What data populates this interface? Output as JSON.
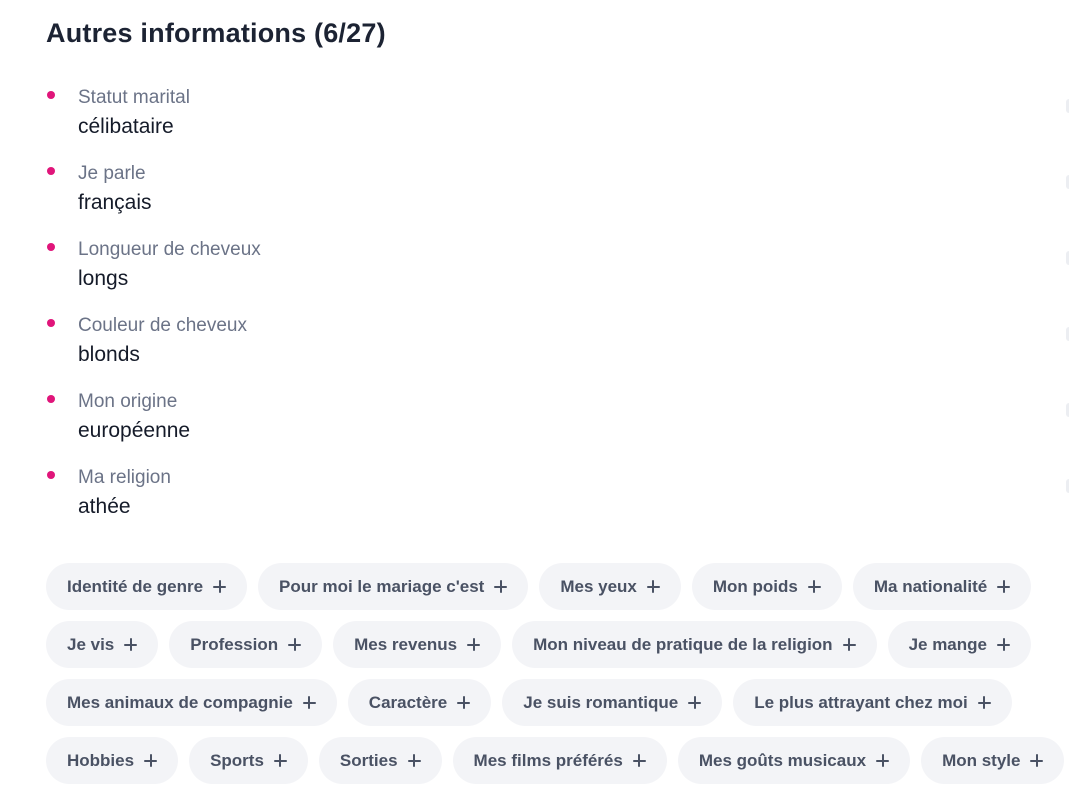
{
  "title": "Autres informations (6/27)",
  "info": [
    {
      "label": "Statut marital",
      "value": "célibataire"
    },
    {
      "label": "Je parle",
      "value": "français"
    },
    {
      "label": "Longueur de cheveux",
      "value": "longs"
    },
    {
      "label": "Couleur de cheveux",
      "value": "blonds"
    },
    {
      "label": "Mon origine",
      "value": "européenne"
    },
    {
      "label": "Ma religion",
      "value": "athée"
    }
  ],
  "chips": {
    "row1": [
      "Identité de genre",
      "Pour moi le mariage c'est",
      "Mes yeux",
      "Mon poids",
      "Ma nationalité"
    ],
    "row2": [
      "Je vis",
      "Profession",
      "Mes revenus",
      "Mon niveau de pratique de la religion",
      "Je mange"
    ],
    "row3": [
      "Mes animaux de compagnie",
      "Caractère",
      "Je suis romantique",
      "Le plus attrayant chez moi"
    ],
    "row4": [
      "Hobbies",
      "Sports",
      "Sorties",
      "Mes films préférés",
      "Mes goûts musicaux",
      "Mon style"
    ]
  },
  "icons": {
    "bullet": "bullet-dot-icon",
    "add": "plus-icon"
  },
  "colors": {
    "bullet": "#e0157a",
    "chip_bg": "#f3f4f7",
    "chip_text": "#4a5264"
  }
}
